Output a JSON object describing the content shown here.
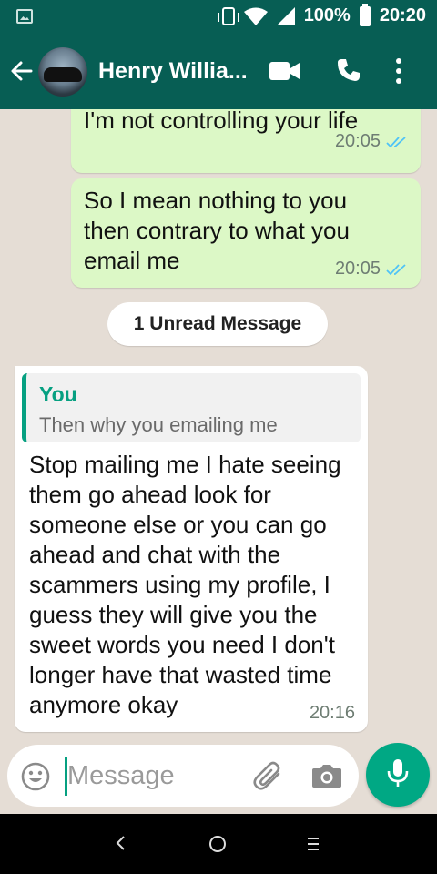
{
  "status_bar": {
    "battery": "100%",
    "time": "20:20"
  },
  "header": {
    "contact_name": "Henry Willia...",
    "icons": [
      "back-arrow-icon",
      "avatar",
      "video-call-icon",
      "phone-icon",
      "more-vert-icon"
    ]
  },
  "messages": [
    {
      "direction": "outgoing",
      "text": "I'm not controlling your life",
      "time": "20:05",
      "status": "read"
    },
    {
      "direction": "outgoing",
      "text": "So I mean nothing to you then contrary to what you email me",
      "time": "20:05",
      "status": "read"
    },
    {
      "direction": "incoming",
      "quote": {
        "author": "You",
        "text": "Then why you emailing me"
      },
      "text": "Stop mailing me I hate seeing them go ahead look for someone else or you can go ahead and chat with the scammers using my profile, I guess they will give you the sweet words you need I don't longer have that wasted time anymore okay",
      "time": "20:16"
    }
  ],
  "unread_label": "1 Unread Message",
  "composer": {
    "placeholder": "Message"
  },
  "colors": {
    "header": "#075e54",
    "outgoing_bubble": "#dcf8c6",
    "accent": "#00a884",
    "read_tick": "#4fc3f7"
  }
}
